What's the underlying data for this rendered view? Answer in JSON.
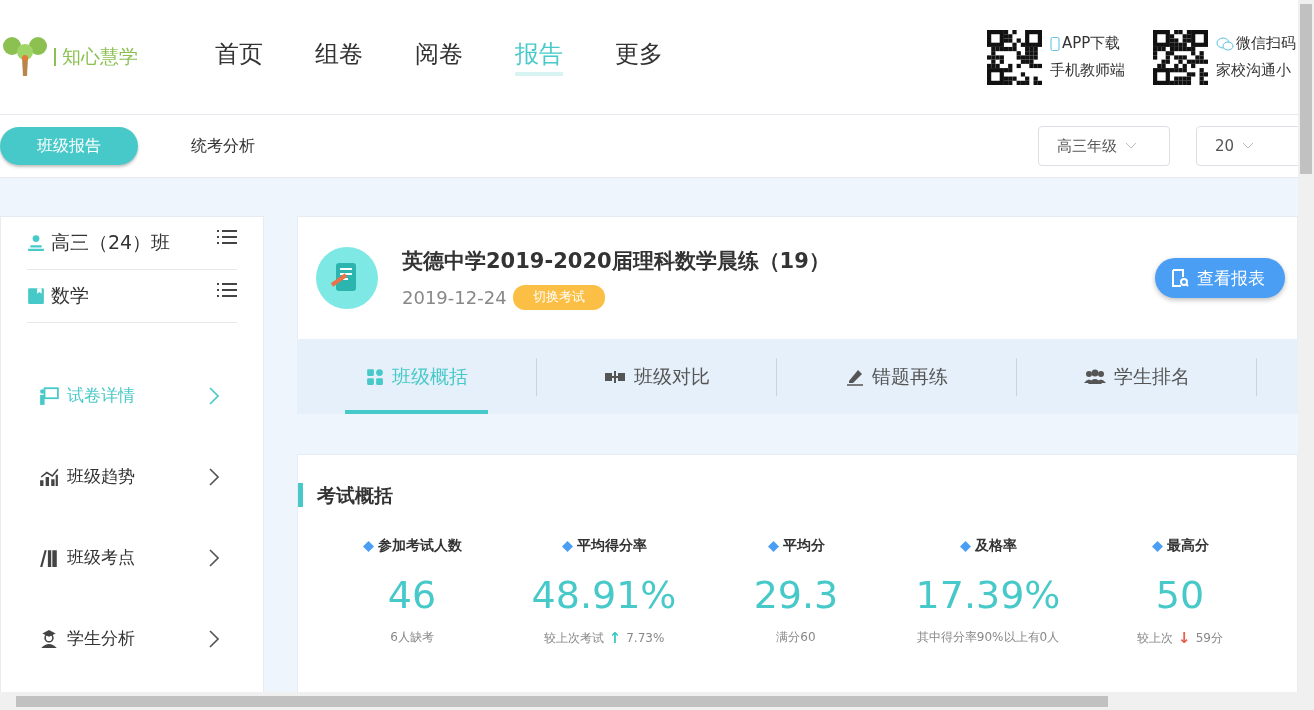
{
  "logo": {
    "text": "知心慧学"
  },
  "nav": [
    {
      "label": "首页",
      "selected": false
    },
    {
      "label": "组卷",
      "selected": false
    },
    {
      "label": "阅卷",
      "selected": false
    },
    {
      "label": "报告",
      "selected": true
    },
    {
      "label": "更多",
      "selected": false
    }
  ],
  "promos": [
    {
      "kind": "app",
      "title": "APP下载",
      "subtitle": "手机教师端"
    },
    {
      "kind": "wechat",
      "title": "微信扫码",
      "subtitle": "家校沟通小"
    }
  ],
  "subnav": [
    {
      "label": "班级报告",
      "selected": true
    },
    {
      "label": "统考分析",
      "selected": false
    }
  ],
  "filters": [
    {
      "value": "高三年级"
    },
    {
      "value": "20"
    }
  ],
  "sidebar": {
    "selectors": [
      {
        "kind": "class",
        "label": "高三（24）班"
      },
      {
        "kind": "subject",
        "label": "数学"
      }
    ],
    "items": [
      {
        "kind": "paper",
        "label": "试卷详情",
        "selected": true
      },
      {
        "kind": "trend",
        "label": "班级趋势",
        "selected": false
      },
      {
        "kind": "points",
        "label": "班级考点",
        "selected": false
      },
      {
        "kind": "student",
        "label": "学生分析",
        "selected": false
      }
    ]
  },
  "exam": {
    "title": "英德中学2019-2020届理科数学晨练（19）",
    "date": "2019-12-24",
    "switch_button": "切换考试",
    "report_button": "查看报表"
  },
  "tabs": [
    {
      "kind": "overview",
      "label": "班级概括",
      "selected": true
    },
    {
      "kind": "compare",
      "label": "班级对比",
      "selected": false
    },
    {
      "kind": "mistakes",
      "label": "错题再练",
      "selected": false
    },
    {
      "kind": "ranking",
      "label": "学生排名",
      "selected": false
    }
  ],
  "summary": {
    "title": "考试概括",
    "stats": [
      {
        "label": "参加考试人数",
        "value": "46",
        "note": "6人缺考"
      },
      {
        "label": "平均得分率",
        "value": "48.91%",
        "note": "较上次考试",
        "change": {
          "arrow": "↑",
          "color": "#3cc7c4",
          "value": "7.73%"
        }
      },
      {
        "label": "平均分",
        "value": "29.3",
        "note": "满分60"
      },
      {
        "label": "及格率",
        "value": "17.39%",
        "note": "其中得分率90%以上有0人"
      },
      {
        "label": "最高分",
        "value": "50",
        "note": "较上次",
        "change": {
          "arrow": "↓",
          "color": "#e8604c",
          "value": "59分"
        }
      }
    ]
  }
}
